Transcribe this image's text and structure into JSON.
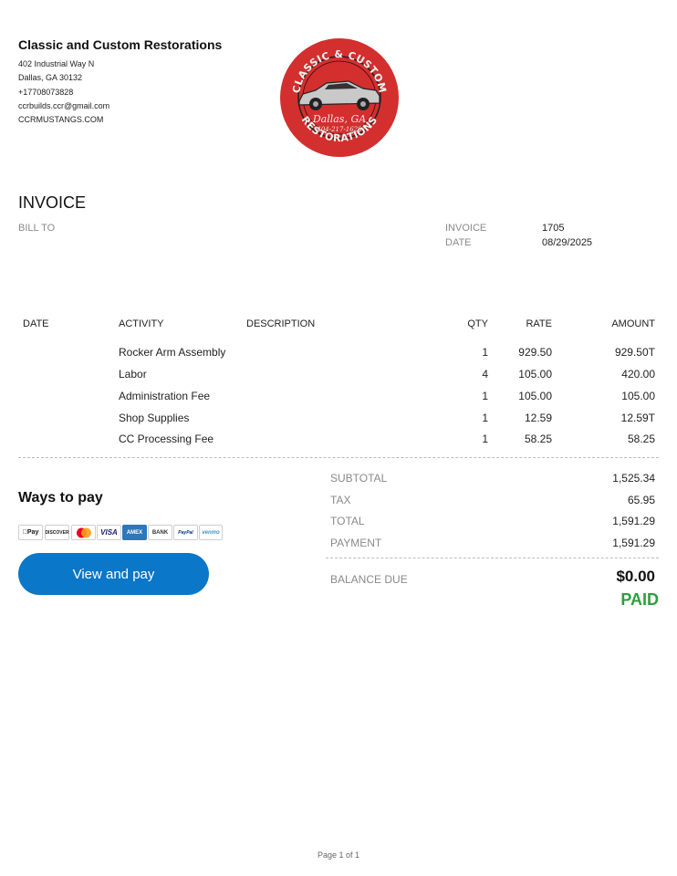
{
  "company": {
    "name": "Classic and Custom Restorations",
    "address1": "402 Industrial Way N",
    "address2": "Dallas, GA  30132",
    "phone": "+17708073828",
    "email": "ccrbuilds.ccr@gmail.com",
    "website": "CCRMUSTANGS.COM"
  },
  "logo": {
    "top_text": "CLASSIC & CUSTOM",
    "city": "Dallas, GA",
    "phone": "404-217-1628",
    "bottom_text": "RESTORATIONS",
    "color": "#d32f2f"
  },
  "invoice": {
    "title": "INVOICE",
    "bill_to_label": "BILL TO",
    "number_label": "INVOICE",
    "number": "1705",
    "date_label": "DATE",
    "date": "08/29/2025"
  },
  "table": {
    "headers": {
      "date": "DATE",
      "activity": "ACTIVITY",
      "description": "DESCRIPTION",
      "qty": "QTY",
      "rate": "RATE",
      "amount": "AMOUNT"
    },
    "rows": [
      {
        "activity": "Rocker Arm Assembly",
        "qty": "1",
        "rate": "929.50",
        "amount": "929.50T"
      },
      {
        "activity": "Labor",
        "qty": "4",
        "rate": "105.00",
        "amount": "420.00"
      },
      {
        "activity": "Administration Fee",
        "qty": "1",
        "rate": "105.00",
        "amount": "105.00"
      },
      {
        "activity": "Shop Supplies",
        "qty": "1",
        "rate": "12.59",
        "amount": "12.59T"
      },
      {
        "activity": "CC Processing Fee",
        "qty": "1",
        "rate": "58.25",
        "amount": "58.25"
      }
    ]
  },
  "payment": {
    "heading": "Ways to pay",
    "methods": [
      "Pay",
      "DISCOVER",
      "",
      "VISA",
      "AMEX",
      "BANK",
      "PayPal",
      "venmo"
    ],
    "button_label": "View and pay",
    "button_color": "#0a77c8"
  },
  "summary": {
    "subtotal_label": "SUBTOTAL",
    "subtotal": "1,525.34",
    "tax_label": "TAX",
    "tax": "65.95",
    "total_label": "TOTAL",
    "total": "1,591.29",
    "payment_label": "PAYMENT",
    "payment": "1,591.29",
    "balance_label": "BALANCE DUE",
    "balance": "$0.00",
    "status": "PAID",
    "status_color": "#2e9e3e"
  },
  "footer": {
    "page": "Page 1 of 1"
  }
}
